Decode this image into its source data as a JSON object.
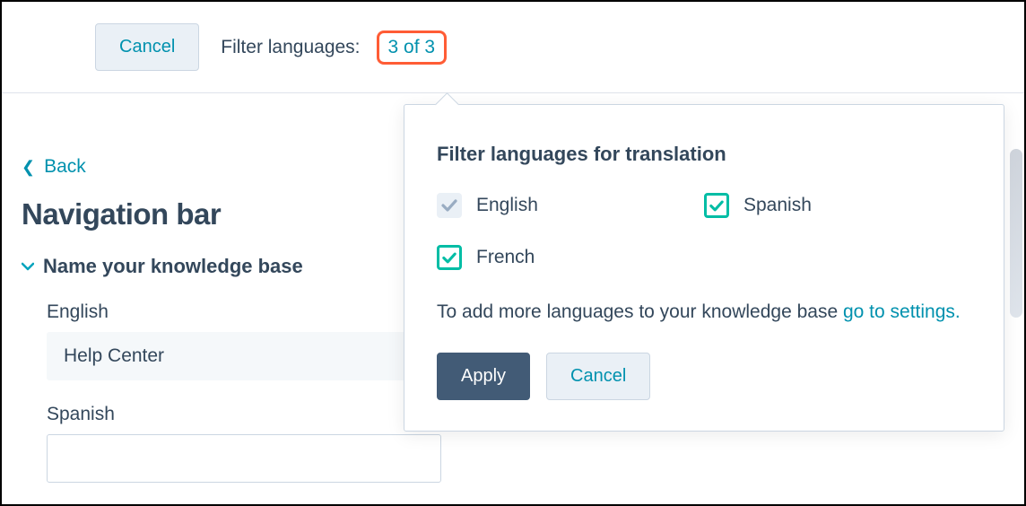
{
  "topbar": {
    "cancel_label": "Cancel",
    "filter_label": "Filter languages:",
    "filter_count": "3 of 3"
  },
  "back": {
    "label": "Back"
  },
  "page": {
    "title": "Navigation bar"
  },
  "section": {
    "title": "Name your knowledge base"
  },
  "fields": {
    "english": {
      "label": "English",
      "value": "Help Center"
    },
    "spanish": {
      "label": "Spanish",
      "value": ""
    }
  },
  "popover": {
    "title": "Filter languages for translation",
    "languages": {
      "english": "English",
      "spanish": "Spanish",
      "french": "French"
    },
    "helper_text": "To add more languages to your knowledge base ",
    "helper_link": "go to settings.",
    "apply_label": "Apply",
    "cancel_label": "Cancel"
  },
  "colors": {
    "accent_teal": "#0091ae",
    "highlight_orange": "#ff5c35",
    "check_green": "#00bda5",
    "primary_btn": "#425b76"
  }
}
